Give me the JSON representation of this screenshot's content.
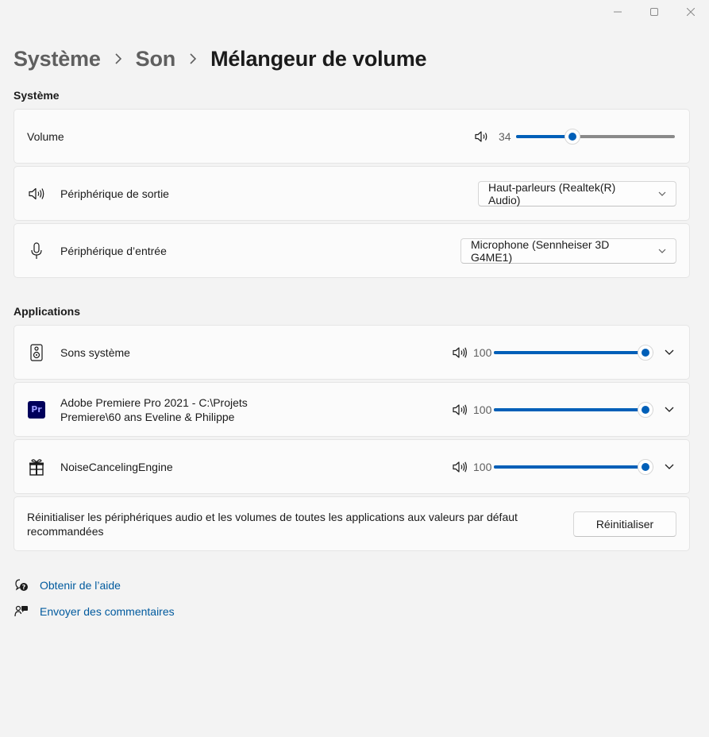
{
  "breadcrumb": {
    "items": [
      "Système",
      "Son"
    ],
    "current": "Mélangeur de volume"
  },
  "system_section": {
    "title": "Système",
    "volume": {
      "label": "Volume",
      "value": "34",
      "level_percent": 34
    },
    "output": {
      "label": "Périphérique de sortie",
      "selected": "Haut-parleurs (Realtek(R) Audio)",
      "icon": "speaker-icon"
    },
    "input": {
      "label": "Périphérique d’entrée",
      "selected": "Microphone (Sennheiser 3D G4ME1)",
      "icon": "microphone-icon"
    }
  },
  "apps_section": {
    "title": "Applications",
    "apps": [
      {
        "name_line1": "Sons système",
        "name_line2": "",
        "volume": "100",
        "level_percent": 100,
        "icon": "system-speaker-icon"
      },
      {
        "name_line1": "Adobe Premiere Pro 2021 - C:\\Projets",
        "name_line2": "Premiere\\60 ans Eveline & Philippe",
        "volume": "100",
        "level_percent": 100,
        "icon": "premiere-pro-icon",
        "icon_text": "Pr"
      },
      {
        "name_line1": "NoiseCancelingEngine",
        "name_line2": "",
        "volume": "100",
        "level_percent": 100,
        "icon": "app-package-icon"
      }
    ]
  },
  "reset": {
    "text_line1": "Réinitialiser les périphériques audio et les volumes de toutes les applications aux valeurs par défaut",
    "text_line2": "recommandées",
    "button": "Réinitialiser"
  },
  "links": {
    "help": "Obtenir de l’aide",
    "feedback": "Envoyer des commentaires"
  },
  "colors": {
    "accent": "#005fb8",
    "link": "#005a9e",
    "background": "#f3f3f3",
    "card": "#fbfbfb"
  }
}
